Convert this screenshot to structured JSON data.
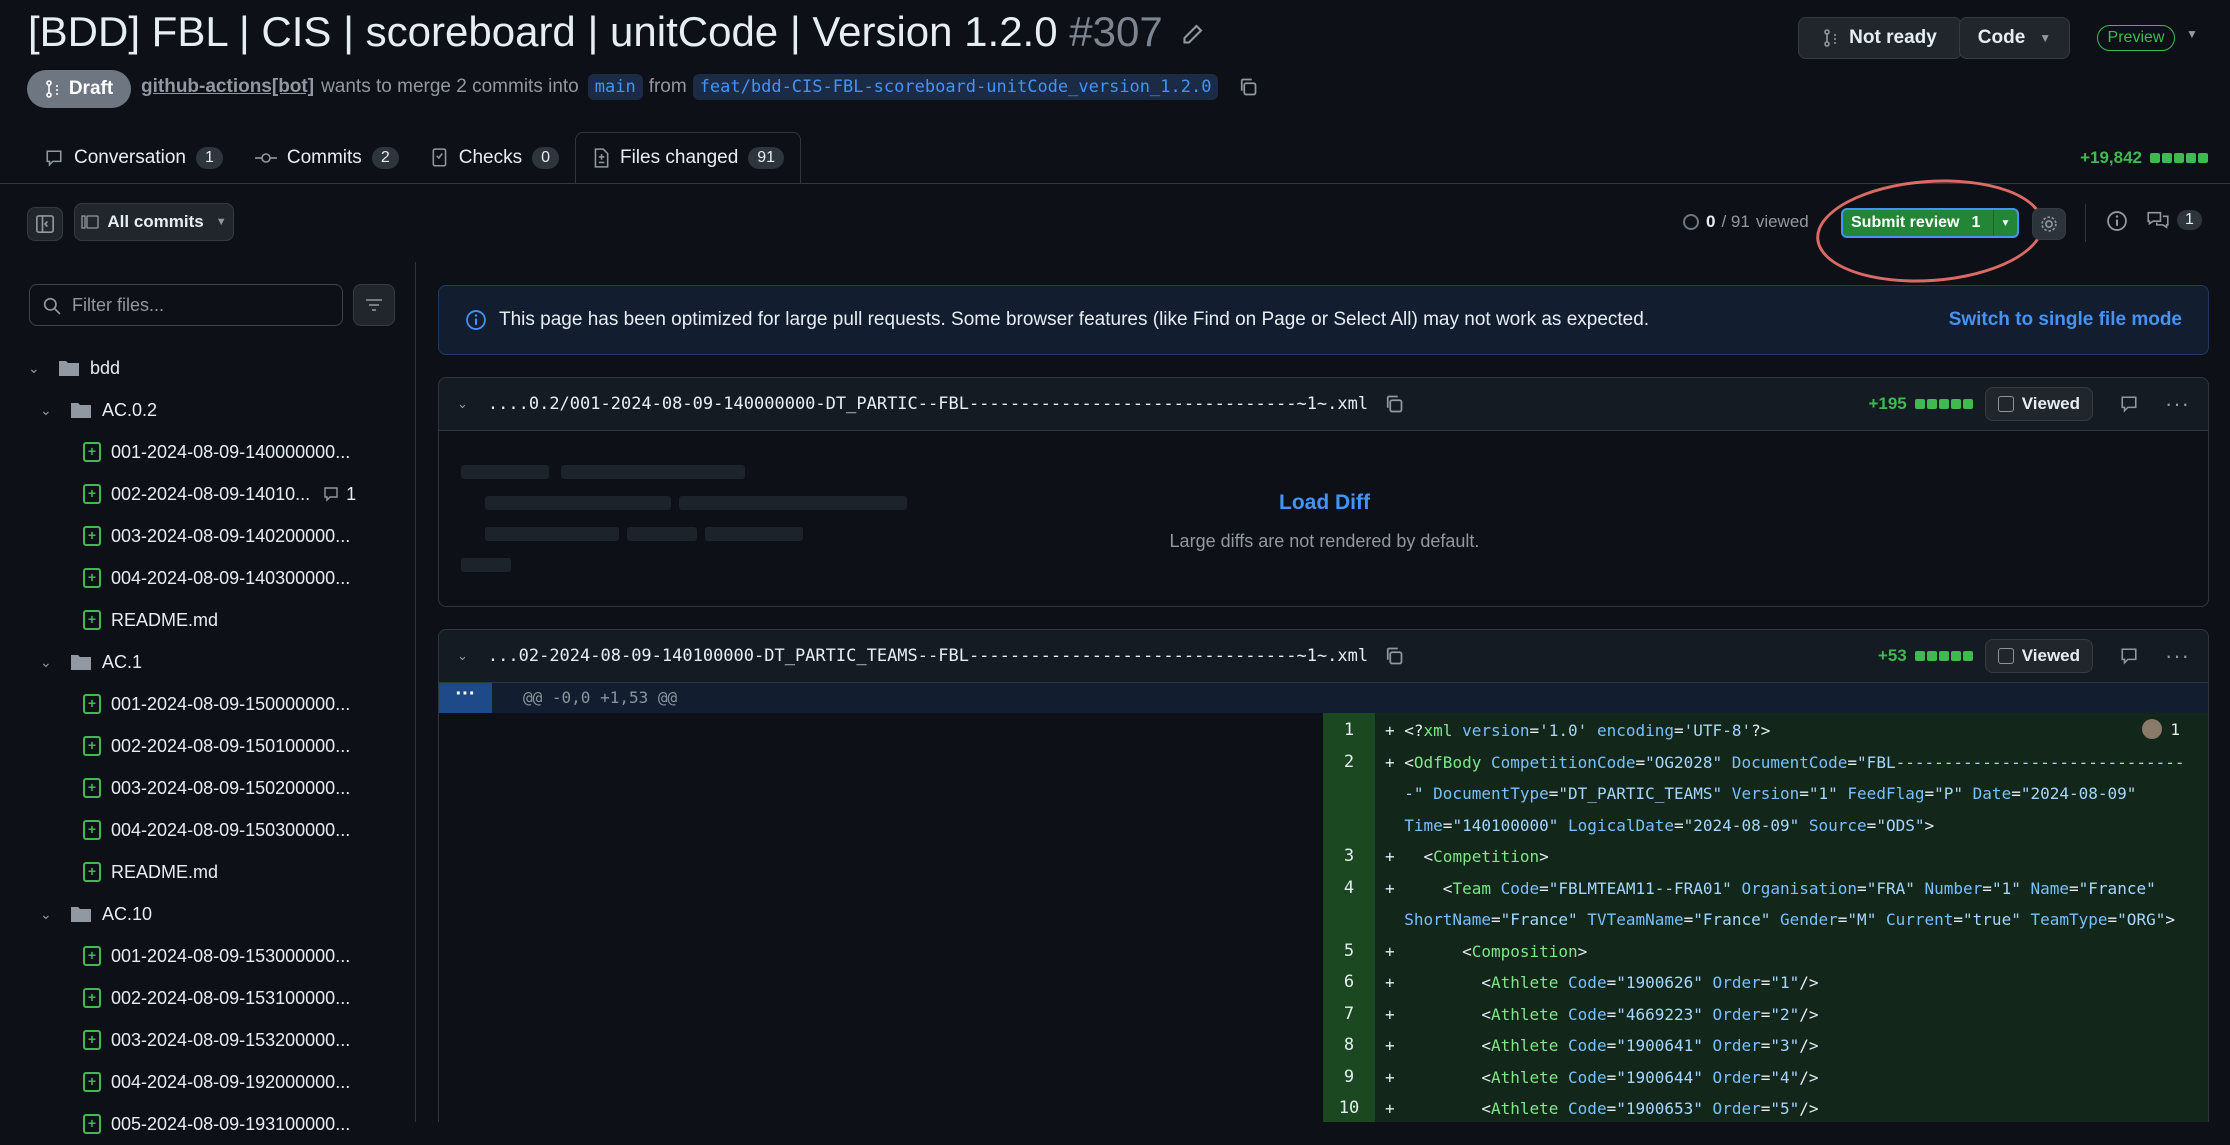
{
  "header": {
    "title": "[BDD] FBL | CIS | scoreboard | unitCode | Version 1.2.0",
    "number": "#307",
    "state": "Draft",
    "author": "github-actions[bot]",
    "merge_text": "wants to merge 2 commits into",
    "base_branch": "main",
    "from_text": "from",
    "head_branch": "feat/bdd-CIS-FBL-scoreboard-unitCode_version_1.2.0",
    "not_ready_label": "Not ready",
    "code_label": "Code",
    "preview_label": "Preview"
  },
  "tabs": [
    {
      "label": "Conversation",
      "count": "1"
    },
    {
      "label": "Commits",
      "count": "2"
    },
    {
      "label": "Checks",
      "count": "0"
    },
    {
      "label": "Files changed",
      "count": "91"
    }
  ],
  "diffstat": "+19,842",
  "toolbar": {
    "all_commits": "All commits",
    "viewed_count": "0",
    "viewed_total": "/ 91",
    "viewed_label": "viewed",
    "submit_label": "Submit review",
    "submit_count": "1",
    "comments_count": "1"
  },
  "sidebar": {
    "filter_placeholder": "Filter files...",
    "tree": [
      {
        "kind": "dir",
        "name": "bdd",
        "depth": 0
      },
      {
        "kind": "dir",
        "name": "AC.0.2",
        "depth": 1
      },
      {
        "kind": "file",
        "name": "001-2024-08-09-140000000...",
        "depth": 2
      },
      {
        "kind": "file",
        "name": "002-2024-08-09-14010...",
        "depth": 2,
        "comments": "1"
      },
      {
        "kind": "file",
        "name": "003-2024-08-09-140200000...",
        "depth": 2
      },
      {
        "kind": "file",
        "name": "004-2024-08-09-140300000...",
        "depth": 2
      },
      {
        "kind": "file",
        "name": "README.md",
        "depth": 2
      },
      {
        "kind": "dir",
        "name": "AC.1",
        "depth": 1
      },
      {
        "kind": "file",
        "name": "001-2024-08-09-150000000...",
        "depth": 2
      },
      {
        "kind": "file",
        "name": "002-2024-08-09-150100000...",
        "depth": 2
      },
      {
        "kind": "file",
        "name": "003-2024-08-09-150200000...",
        "depth": 2
      },
      {
        "kind": "file",
        "name": "004-2024-08-09-150300000...",
        "depth": 2
      },
      {
        "kind": "file",
        "name": "README.md",
        "depth": 2
      },
      {
        "kind": "dir",
        "name": "AC.10",
        "depth": 1
      },
      {
        "kind": "file",
        "name": "001-2024-08-09-153000000...",
        "depth": 2
      },
      {
        "kind": "file",
        "name": "002-2024-08-09-153100000...",
        "depth": 2
      },
      {
        "kind": "file",
        "name": "003-2024-08-09-153200000...",
        "depth": 2
      },
      {
        "kind": "file",
        "name": "004-2024-08-09-192000000...",
        "depth": 2
      },
      {
        "kind": "file",
        "name": "005-2024-08-09-193100000...",
        "depth": 2
      }
    ]
  },
  "banner": {
    "message": "This page has been optimized for large pull requests. Some browser features (like Find on Page or Select All) may not work as expected.",
    "link": "Switch to single file mode"
  },
  "files": [
    {
      "name": "....0.2/001-2024-08-09-140000000-DT_PARTIC--FBL--------------------------------~1~.xml",
      "additions": "+195",
      "viewed_label": "Viewed",
      "load_diff": "Load Diff",
      "large_note": "Large diffs are not rendered by default."
    },
    {
      "name": "...02-2024-08-09-140100000-DT_PARTIC_TEAMS--FBL--------------------------------~1~.xml",
      "additions": "+53",
      "viewed_label": "Viewed",
      "hunk": "@@ -0,0 +1,53 @@",
      "reviewer_count": "1"
    }
  ],
  "code_lines": [
    {
      "n": "1",
      "segs": [
        [
          "p",
          "+ "
        ],
        [
          "p",
          "<?"
        ],
        [
          "tg",
          "xml"
        ],
        [
          "at",
          " version"
        ],
        [
          "p",
          "="
        ],
        [
          "st",
          "'1.0'"
        ],
        [
          "at",
          " encoding"
        ],
        [
          "p",
          "="
        ],
        [
          "st",
          "'UTF-8'"
        ],
        [
          "p",
          "?>"
        ]
      ]
    },
    {
      "n": "2",
      "segs": [
        [
          "p",
          "+ <"
        ],
        [
          "tg",
          "OdfBody"
        ],
        [
          "at",
          " CompetitionCode"
        ],
        [
          "p",
          "="
        ],
        [
          "st",
          "\"OG2028\""
        ],
        [
          "at",
          " DocumentCode"
        ],
        [
          "p",
          "="
        ],
        [
          "st",
          "\"FBL------------------------------"
        ]
      ]
    },
    {
      "n": "",
      "segs": [
        [
          "st",
          "  -\""
        ],
        [
          "at",
          " DocumentType"
        ],
        [
          "p",
          "="
        ],
        [
          "st",
          "\"DT_PARTIC_TEAMS\""
        ],
        [
          "at",
          " Version"
        ],
        [
          "p",
          "="
        ],
        [
          "st",
          "\"1\""
        ],
        [
          "at",
          " FeedFlag"
        ],
        [
          "p",
          "="
        ],
        [
          "st",
          "\"P\""
        ],
        [
          "at",
          " Date"
        ],
        [
          "p",
          "="
        ],
        [
          "st",
          "\"2024-08-09\""
        ]
      ]
    },
    {
      "n": "",
      "segs": [
        [
          "at",
          "  Time"
        ],
        [
          "p",
          "="
        ],
        [
          "st",
          "\"140100000\""
        ],
        [
          "at",
          " LogicalDate"
        ],
        [
          "p",
          "="
        ],
        [
          "st",
          "\"2024-08-09\""
        ],
        [
          "at",
          " Source"
        ],
        [
          "p",
          "="
        ],
        [
          "st",
          "\"ODS\""
        ],
        [
          "p",
          ">"
        ]
      ]
    },
    {
      "n": "3",
      "segs": [
        [
          "p",
          "+   <"
        ],
        [
          "tg",
          "Competition"
        ],
        [
          "p",
          ">"
        ]
      ]
    },
    {
      "n": "4",
      "segs": [
        [
          "p",
          "+     <"
        ],
        [
          "tg",
          "Team"
        ],
        [
          "at",
          " Code"
        ],
        [
          "p",
          "="
        ],
        [
          "st",
          "\"FBLMTEAM11--FRA01\""
        ],
        [
          "at",
          " Organisation"
        ],
        [
          "p",
          "="
        ],
        [
          "st",
          "\"FRA\""
        ],
        [
          "at",
          " Number"
        ],
        [
          "p",
          "="
        ],
        [
          "st",
          "\"1\""
        ],
        [
          "at",
          " Name"
        ],
        [
          "p",
          "="
        ],
        [
          "st",
          "\"France\""
        ]
      ]
    },
    {
      "n": "",
      "segs": [
        [
          "at",
          "  ShortName"
        ],
        [
          "p",
          "="
        ],
        [
          "st",
          "\"France\""
        ],
        [
          "at",
          " TVTeamName"
        ],
        [
          "p",
          "="
        ],
        [
          "st",
          "\"France\""
        ],
        [
          "at",
          " Gender"
        ],
        [
          "p",
          "="
        ],
        [
          "st",
          "\"M\""
        ],
        [
          "at",
          " Current"
        ],
        [
          "p",
          "="
        ],
        [
          "st",
          "\"true\""
        ],
        [
          "at",
          " TeamType"
        ],
        [
          "p",
          "="
        ],
        [
          "st",
          "\"ORG\""
        ],
        [
          "p",
          ">"
        ]
      ]
    },
    {
      "n": "5",
      "segs": [
        [
          "p",
          "+       <"
        ],
        [
          "tg",
          "Composition"
        ],
        [
          "p",
          ">"
        ]
      ]
    },
    {
      "n": "6",
      "segs": [
        [
          "p",
          "+         <"
        ],
        [
          "tg",
          "Athlete"
        ],
        [
          "at",
          " Code"
        ],
        [
          "p",
          "="
        ],
        [
          "st",
          "\"1900626\""
        ],
        [
          "at",
          " Order"
        ],
        [
          "p",
          "="
        ],
        [
          "st",
          "\"1\""
        ],
        [
          "p",
          "/>"
        ]
      ]
    },
    {
      "n": "7",
      "segs": [
        [
          "p",
          "+         <"
        ],
        [
          "tg",
          "Athlete"
        ],
        [
          "at",
          " Code"
        ],
        [
          "p",
          "="
        ],
        [
          "st",
          "\"4669223\""
        ],
        [
          "at",
          " Order"
        ],
        [
          "p",
          "="
        ],
        [
          "st",
          "\"2\""
        ],
        [
          "p",
          "/>"
        ]
      ]
    },
    {
      "n": "8",
      "segs": [
        [
          "p",
          "+         <"
        ],
        [
          "tg",
          "Athlete"
        ],
        [
          "at",
          " Code"
        ],
        [
          "p",
          "="
        ],
        [
          "st",
          "\"1900641\""
        ],
        [
          "at",
          " Order"
        ],
        [
          "p",
          "="
        ],
        [
          "st",
          "\"3\""
        ],
        [
          "p",
          "/>"
        ]
      ]
    },
    {
      "n": "9",
      "segs": [
        [
          "p",
          "+         <"
        ],
        [
          "tg",
          "Athlete"
        ],
        [
          "at",
          " Code"
        ],
        [
          "p",
          "="
        ],
        [
          "st",
          "\"1900644\""
        ],
        [
          "at",
          " Order"
        ],
        [
          "p",
          "="
        ],
        [
          "st",
          "\"4\""
        ],
        [
          "p",
          "/>"
        ]
      ]
    },
    {
      "n": "10",
      "segs": [
        [
          "p",
          "+         <"
        ],
        [
          "tg",
          "Athlete"
        ],
        [
          "at",
          " Code"
        ],
        [
          "p",
          "="
        ],
        [
          "st",
          "\"1900653\""
        ],
        [
          "at",
          " Order"
        ],
        [
          "p",
          "="
        ],
        [
          "st",
          "\"5\""
        ],
        [
          "p",
          "/>"
        ]
      ]
    }
  ]
}
